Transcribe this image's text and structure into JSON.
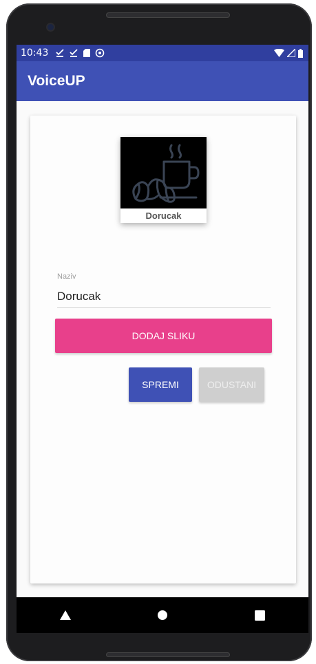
{
  "status_bar": {
    "time": "10:43"
  },
  "app_bar": {
    "title": "VoiceUP"
  },
  "category_image": {
    "caption": "Dorucak"
  },
  "name_field": {
    "label": "Naziv",
    "value": "Dorucak"
  },
  "buttons": {
    "add_image": "DODAJ SLIKU",
    "save": "SPREMI",
    "cancel": "ODUSTANI"
  },
  "colors": {
    "primary": "#3f51b5",
    "primary_dark": "#303f9f",
    "accent": "#e8408b",
    "disabled": "#cfcfcf"
  },
  "icons": {
    "status": [
      "download-done-icon",
      "download-done-icon",
      "sd-card-icon",
      "sync-icon"
    ],
    "status_right": [
      "wifi-icon",
      "signal-icon",
      "battery-icon"
    ],
    "image": "breakfast-icon",
    "nav": [
      "back-icon",
      "home-icon",
      "recents-icon"
    ]
  }
}
